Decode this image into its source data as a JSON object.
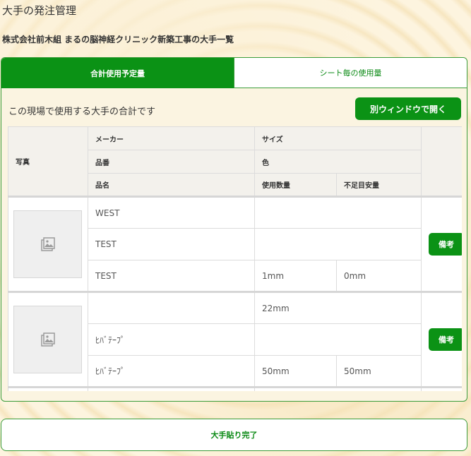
{
  "page": {
    "title": "大手の発注管理"
  },
  "site": {
    "title": "株式会社前木組 まるの脳神経クリニック新築工事の大手一覧"
  },
  "tabs": [
    {
      "label": "合計使用予定量",
      "active": true
    },
    {
      "label": "シート毎の使用量",
      "active": false
    }
  ],
  "summary": {
    "text": "この現場で使用する大手の合計です",
    "open_window_label": "別ウィンドウで開く"
  },
  "table": {
    "headers": {
      "photo": "写真",
      "maker": "メーカー",
      "size": "サイズ",
      "part_no": "品番",
      "color": "色",
      "name": "品名",
      "qty": "使用数量",
      "shortage": "不足目安量"
    },
    "rows": [
      {
        "maker": "WEST",
        "size": "",
        "part_no": "TEST",
        "color": "",
        "name": "TEST",
        "qty": "1mm",
        "shortage": "0mm",
        "note_label": "備考"
      },
      {
        "maker": "",
        "size": "22mm",
        "part_no": "ﾋﾊﾞﾃｰﾌﾟ",
        "color": "",
        "name": "ﾋﾊﾞﾃｰﾌﾟ",
        "qty": "50mm",
        "shortage": "50mm",
        "note_label": "備考"
      }
    ]
  },
  "footer": {
    "complete_label": "大手貼り完了"
  },
  "colors": {
    "accent": "#0b9215",
    "border": "#3a9c3a"
  },
  "icons": {
    "photo_placeholder": "image-icon"
  }
}
